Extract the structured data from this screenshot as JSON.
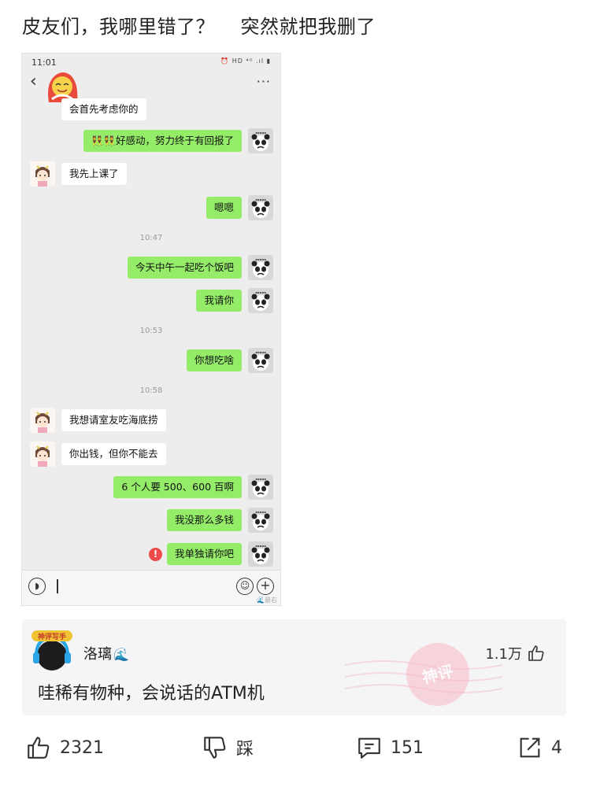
{
  "post": {
    "title": "皮友们，我哪里错了？    突然就把我删了"
  },
  "phone": {
    "status_time": "11:01",
    "status_icons": "⏰ HD ⁴ᴳ .ıl ▮",
    "watermark": "🌊最右",
    "messages": [
      {
        "side": "in",
        "text": "会首先考虑你的"
      },
      {
        "side": "out",
        "text": "👯👯好感动，努力终于有回报了"
      },
      {
        "side": "in",
        "text": "我先上课了"
      },
      {
        "side": "out",
        "text": "嗯嗯"
      },
      {
        "side": "out",
        "text": "今天中午一起吃个饭吧"
      },
      {
        "side": "out",
        "text": "我请你"
      },
      {
        "side": "out",
        "text": "你想吃啥"
      },
      {
        "side": "in",
        "text": "我想请室友吃海底捞"
      },
      {
        "side": "in",
        "text": "你出钱，但你不能去"
      },
      {
        "side": "out",
        "text": "6 个人要 500、600 百啊"
      },
      {
        "side": "out",
        "text": "我没那么多钱"
      },
      {
        "side": "out",
        "text": "我单独请你吧"
      }
    ],
    "timestamps": [
      "10:47",
      "10:53",
      "10:58"
    ],
    "error_mark": "!"
  },
  "comment": {
    "avatar_badge": "神评写手",
    "username": "洛璃",
    "username_suffix": "🌊",
    "likes": "1.1万",
    "text": "哇稀有物种，会说话的ATM机",
    "stamp": "神评"
  },
  "actions": {
    "like_count": "2321",
    "dislike_label": "踩",
    "comment_count": "151",
    "share_count": "4"
  },
  "colors": {
    "bubble_out": "#95ec69",
    "bubble_in": "#ffffff",
    "chat_bg": "#ededed",
    "comment_bg": "#f5f5f7",
    "error_red": "#ef4a4a"
  }
}
